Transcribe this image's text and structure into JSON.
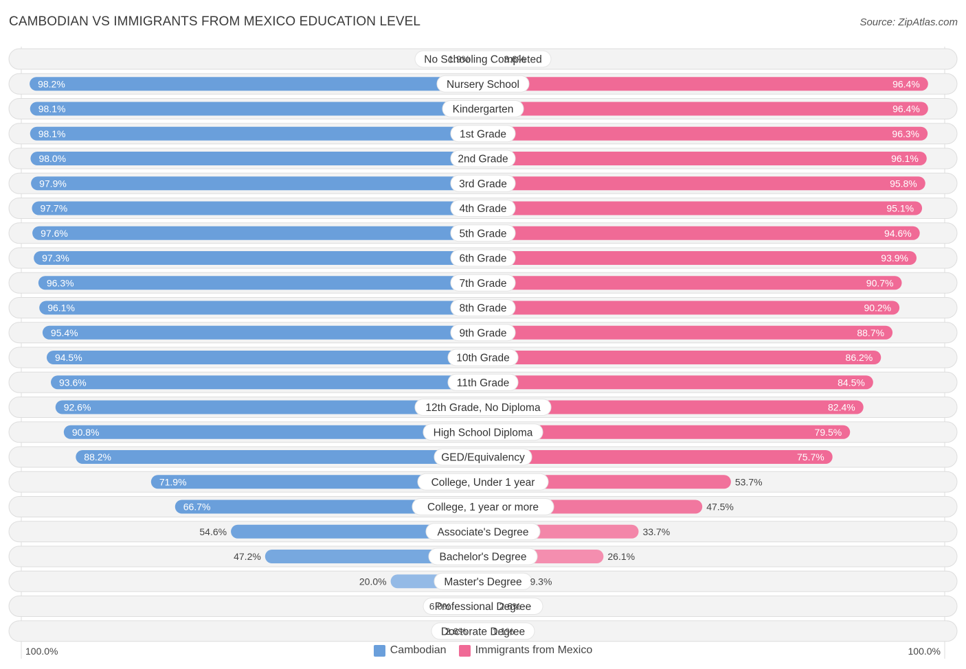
{
  "title": "CAMBODIAN VS IMMIGRANTS FROM MEXICO EDUCATION LEVEL",
  "source": "Source: ZipAtlas.com",
  "axis": {
    "left_label": "100.0%",
    "right_label": "100.0%"
  },
  "colors": {
    "left_strong": "#6a9fdb",
    "left_light": "#a9c8ec",
    "right_strong": "#f06a96",
    "right_light": "#f7a9c2",
    "track": "#f3f3f3"
  },
  "legend": [
    {
      "label": "Cambodian",
      "color": "#6a9fdb"
    },
    {
      "label": "Immigrants from Mexico",
      "color": "#f06a96"
    }
  ],
  "chart_data": {
    "type": "bar",
    "orientation": "horizontal-diverging",
    "title": "CAMBODIAN VS IMMIGRANTS FROM MEXICO EDUCATION LEVEL",
    "xlim": [
      0,
      100
    ],
    "unit": "%",
    "categories": [
      "No Schooling Completed",
      "Nursery School",
      "Kindergarten",
      "1st Grade",
      "2nd Grade",
      "3rd Grade",
      "4th Grade",
      "5th Grade",
      "6th Grade",
      "7th Grade",
      "8th Grade",
      "9th Grade",
      "10th Grade",
      "11th Grade",
      "12th Grade, No Diploma",
      "High School Diploma",
      "GED/Equivalency",
      "College, Under 1 year",
      "College, 1 year or more",
      "Associate's Degree",
      "Bachelor's Degree",
      "Master's Degree",
      "Professional Degree",
      "Doctorate Degree"
    ],
    "series": [
      {
        "name": "Cambodian",
        "side": "left",
        "values": [
          1.9,
          98.2,
          98.1,
          98.1,
          98.0,
          97.9,
          97.7,
          97.6,
          97.3,
          96.3,
          96.1,
          95.4,
          94.5,
          93.6,
          92.6,
          90.8,
          88.2,
          71.9,
          66.7,
          54.6,
          47.2,
          20.0,
          6.0,
          2.6
        ]
      },
      {
        "name": "Immigrants from Mexico",
        "side": "right",
        "values": [
          3.6,
          96.4,
          96.4,
          96.3,
          96.1,
          95.8,
          95.1,
          94.6,
          93.9,
          90.7,
          90.2,
          88.7,
          86.2,
          84.5,
          82.4,
          79.5,
          75.7,
          53.7,
          47.5,
          33.7,
          26.1,
          9.3,
          2.6,
          1.1
        ]
      }
    ],
    "legend_position": "bottom-center"
  }
}
